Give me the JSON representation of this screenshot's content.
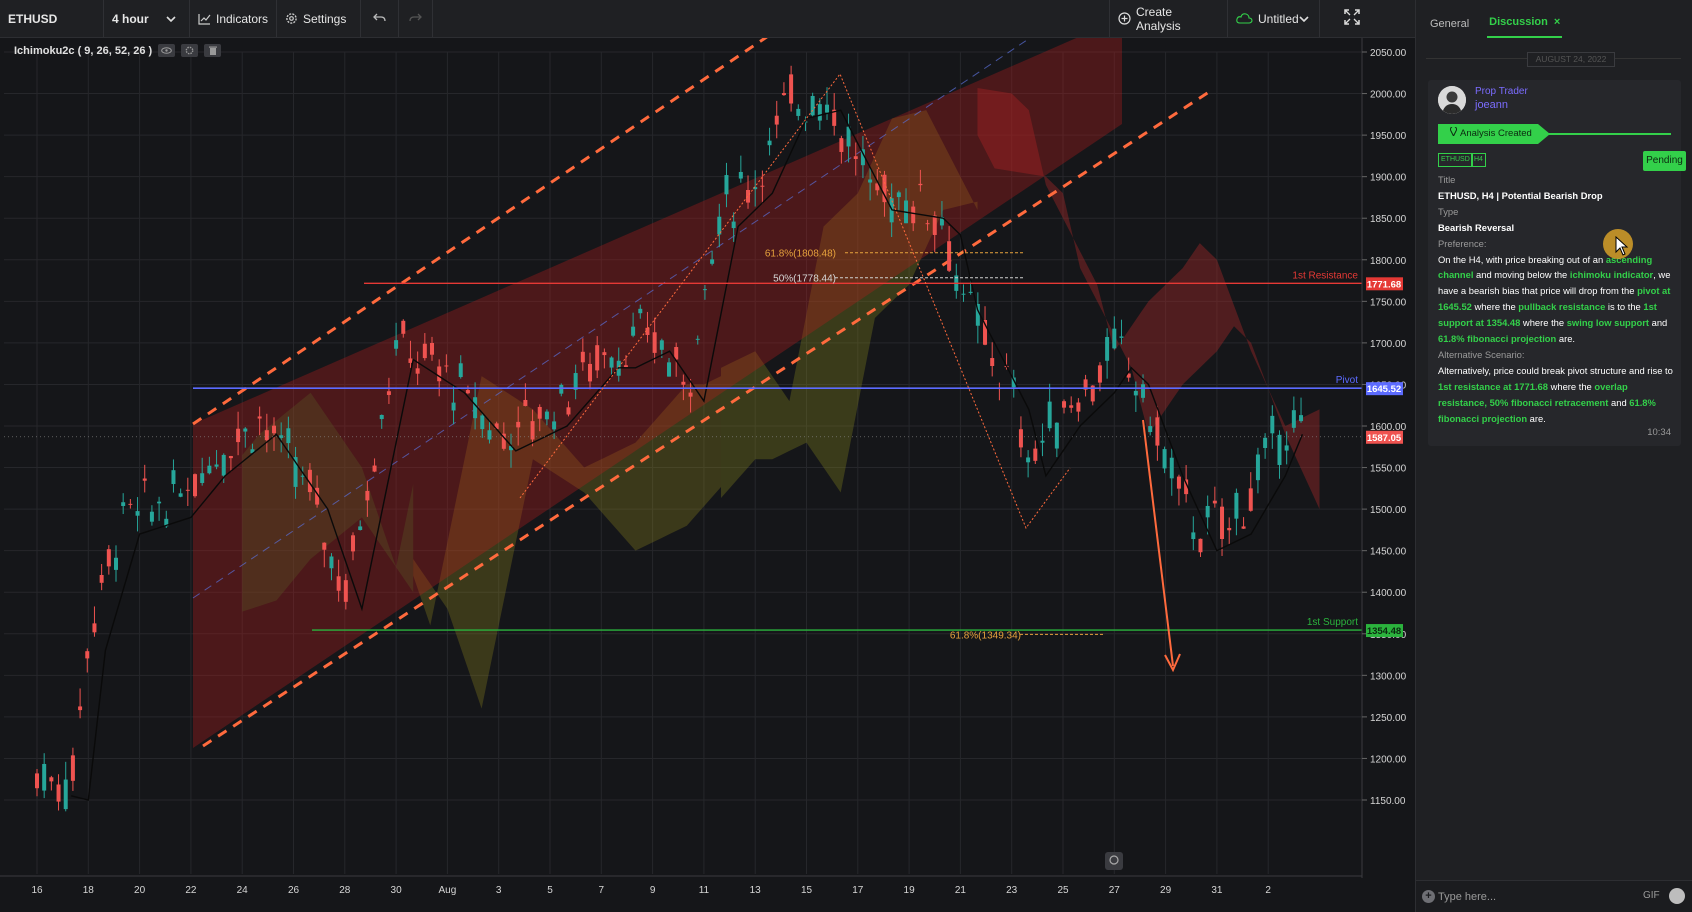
{
  "toolbar": {
    "symbol": "ETHUSD",
    "timeframe": "4 hour",
    "indicators_label": "Indicators",
    "settings_label": "Settings",
    "create_label": "Create Analysis",
    "untitled_label": "Untitled"
  },
  "indicator": {
    "label": "Ichimoku2c ( 9, 26, 52, 26 )"
  },
  "chart": {
    "price_ticks": [
      "2050.00",
      "2000.00",
      "1950.00",
      "1900.00",
      "1850.00",
      "1800.00",
      "1750.00",
      "1700.00",
      "1650.00",
      "1600.00",
      "1550.00",
      "1500.00",
      "1450.00",
      "1400.00",
      "1350.00",
      "1300.00",
      "1250.00",
      "1200.00",
      "1150.00"
    ],
    "date_ticks": [
      "16",
      "18",
      "20",
      "22",
      "24",
      "26",
      "28",
      "30",
      "Aug",
      "3",
      "5",
      "7",
      "9",
      "11",
      "13",
      "15",
      "17",
      "19",
      "21",
      "23",
      "25",
      "27",
      "29",
      "31",
      "2"
    ],
    "badges": {
      "resistance": "1771.68",
      "pivot": "1645.52",
      "current": "1587.05",
      "support": "1354.48"
    },
    "line_labels": {
      "resistance": "1st Resistance",
      "pivot": "Pivot",
      "support": "1st Support"
    },
    "fib_labels": {
      "f618_top": "61.8%(1808.48)",
      "f50": "50%(1778.44)",
      "f618_bottom": "61.8%(1349.34)"
    }
  },
  "chart_data": {
    "type": "candlestick",
    "symbol": "ETHUSD",
    "ylim": [
      1150,
      2050
    ],
    "levels": {
      "resistance": 1771.68,
      "pivot": 1645.52,
      "support": 1354.48,
      "current": 1587.05
    },
    "fib": {
      "f618_top": 1808.48,
      "f50": 1778.44,
      "f618_bottom": 1349.34
    },
    "price_path": [
      [
        0,
        1180
      ],
      [
        2,
        1170
      ],
      [
        3,
        1350
      ],
      [
        5,
        1490
      ],
      [
        8,
        1510
      ],
      [
        10,
        1560
      ],
      [
        13,
        1610
      ],
      [
        16,
        1520
      ],
      [
        18,
        1400
      ],
      [
        21,
        1700
      ],
      [
        24,
        1660
      ],
      [
        27,
        1590
      ],
      [
        30,
        1620
      ],
      [
        33,
        1690
      ],
      [
        34,
        1690
      ],
      [
        36,
        1710
      ],
      [
        38,
        1650
      ],
      [
        40,
        1860
      ],
      [
        42,
        1900
      ],
      [
        44,
        1990
      ],
      [
        46,
        2000
      ],
      [
        47,
        1960
      ],
      [
        49,
        1880
      ],
      [
        52,
        1870
      ],
      [
        53,
        1850
      ],
      [
        54,
        1760
      ],
      [
        56,
        1680
      ],
      [
        57,
        1640
      ],
      [
        58,
        1560
      ],
      [
        60,
        1620
      ],
      [
        62,
        1660
      ],
      [
        63,
        1690
      ],
      [
        64,
        1670
      ],
      [
        66,
        1560
      ],
      [
        68,
        1470
      ],
      [
        70,
        1490
      ],
      [
        72,
        1560
      ],
      [
        73,
        1610
      ],
      [
        74,
        1580
      ]
    ]
  },
  "panel": {
    "tab_general": "General",
    "tab_discussion": "Discussion",
    "tab_close": "×",
    "date": "AUGUST 24, 2022",
    "author_role": "Prop Trader",
    "author_name": "joeann",
    "status": "Analysis Created",
    "tag_symbol": "ETHUSD",
    "tag_tf": "H4",
    "pending": "Pending",
    "title_label": "Title",
    "title_value": "ETHUSD, H4 | Potential Bearish Drop",
    "type_label": "Type",
    "type_value": "Bearish Reversal",
    "pref_label": "Preference:",
    "pref": {
      "t1": "On the H4, with price breaking out of an ",
      "h1": "ascending channel",
      "t2": " and moving below the ",
      "h2": "ichimoku indicator",
      "t3": ", we have a bearish bias that price will drop from the ",
      "h3": "pivot at 1645.52",
      "t4": " where the ",
      "h4": "pullback resistance",
      "t5": " is to the ",
      "h5": "1st support at 1354.48",
      "t6": " where the ",
      "h6": "swing low support",
      "t7": " and ",
      "h7": "61.8% fibonacci projection",
      "t8": " are."
    },
    "alt_label": "Alternative Scenario:",
    "alt": {
      "t1": "Alternatively, price could break pivot structure and rise to ",
      "h1": "1st resistance at 1771.68",
      "t2": " where the ",
      "h2": "overlap resistance, 50% fibonacci retracement",
      "t3": " and ",
      "h3": "61.8% fibonacci projection",
      "t4": " are."
    },
    "time": "10:34",
    "input_placeholder": "Type here...",
    "gif": "GIF"
  },
  "colors": {
    "bull": "#26a69a",
    "bear": "#ef5350",
    "accent": "#33d04a",
    "resistance": "#e53935",
    "pivot": "#5c6bff",
    "support": "#2bb33d",
    "fib": "#e6a23c",
    "trend": "#ff6a3d"
  }
}
